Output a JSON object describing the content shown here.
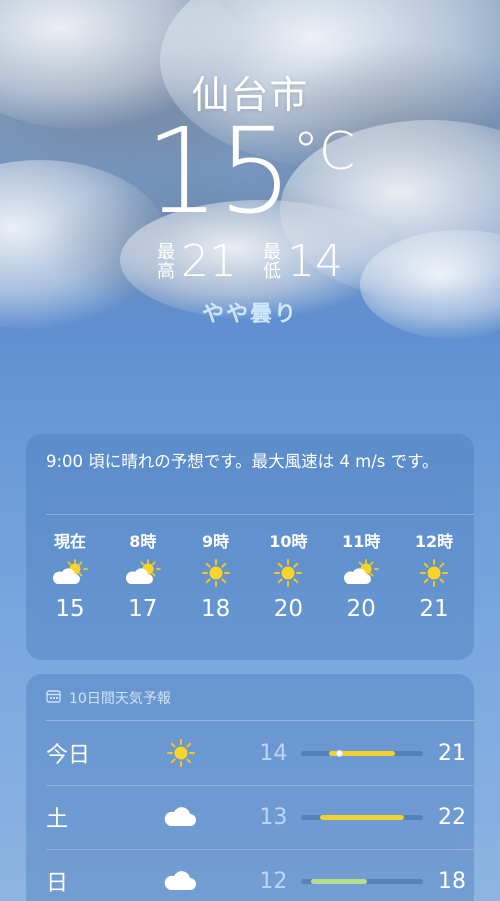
{
  "location": {
    "city": "仙台市"
  },
  "current": {
    "temperature": "15",
    "unit": "°C",
    "high_label": "最高",
    "high": "21",
    "low_label": "最低",
    "low": "14",
    "condition": "やや曇り"
  },
  "hourly": {
    "summary": "9:00 頃に晴れの予想です。最大風速は 4 m/s です。",
    "items": [
      {
        "time": "現在",
        "icon": "partly-cloudy-icon",
        "temp": "15"
      },
      {
        "time": "8時",
        "icon": "partly-cloudy-icon",
        "temp": "17"
      },
      {
        "time": "9時",
        "icon": "sun-icon",
        "temp": "18"
      },
      {
        "time": "10時",
        "icon": "sun-icon",
        "temp": "20"
      },
      {
        "time": "11時",
        "icon": "partly-cloudy-icon",
        "temp": "20"
      },
      {
        "time": "12時",
        "icon": "sun-icon",
        "temp": "21"
      }
    ]
  },
  "daily": {
    "header": "10日間天気予報",
    "header_icon": "calendar-icon",
    "range_min": 11,
    "range_max": 24,
    "items": [
      {
        "day": "今日",
        "icon": "sun-icon",
        "low": "14",
        "high": "21",
        "low_value": 14,
        "high_value": 21,
        "current_value": 15,
        "bar_color": "#f5d033"
      },
      {
        "day": "土",
        "icon": "cloud-icon",
        "low": "13",
        "high": "22",
        "low_value": 13,
        "high_value": 22,
        "bar_color": "#f2d22e"
      },
      {
        "day": "日",
        "icon": "cloud-icon",
        "low": "12",
        "high": "18",
        "low_value": 12,
        "high_value": 18,
        "bar_color": "#b7dc8a"
      }
    ]
  }
}
